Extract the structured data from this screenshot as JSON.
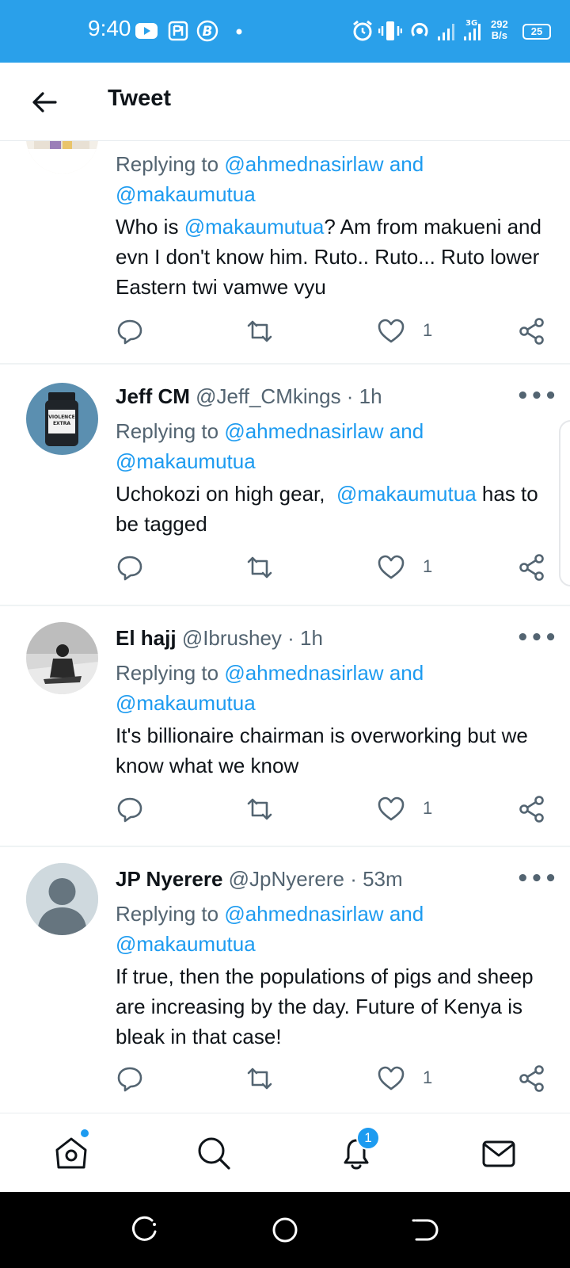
{
  "status_bar": {
    "time": "9:40",
    "net_speed_value": "292",
    "net_speed_unit": "B/s",
    "network_type": "3G",
    "battery": "25"
  },
  "header": {
    "title": "Tweet"
  },
  "colors": {
    "accent": "#1d9bf0",
    "status_bar": "#2aa0ea",
    "muted": "#536471"
  },
  "tweets": [
    {
      "reply_label": "Replying to",
      "reply_to_1": "@ahmednasirlaw",
      "reply_and": "and",
      "reply_to_2": "@makaumutua",
      "text_parts": [
        "Who is ",
        "@makaumutua",
        "? Am from makueni and evn I don't know him. Ruto.. Ruto... Ruto lower Eastern twi vamwe vyu"
      ],
      "likes": "1"
    },
    {
      "name": "Jeff CM",
      "handle": "@Jeff_CMkings",
      "time": "· 1h",
      "reply_label": "Replying to",
      "reply_to_1": "@ahmednasirlaw",
      "reply_and": "and",
      "reply_to_2": "@makaumutua",
      "text_parts": [
        "Uchokozi on high gear,  ",
        "@makaumutua",
        " has to be tagged"
      ],
      "likes": "1"
    },
    {
      "name": "El hajj",
      "handle": "@Ibrushey",
      "time": "· 1h",
      "reply_label": "Replying to",
      "reply_to_1": "@ahmednasirlaw",
      "reply_and": "and",
      "reply_to_2": "@makaumutua",
      "text": "It's billionaire chairman is overworking but we know what we know",
      "likes": "1"
    },
    {
      "name": "JP Nyerere",
      "handle": "@JpNyerere",
      "time": "· 53m",
      "reply_label": "Replying to",
      "reply_to_1": "@ahmednasirlaw",
      "reply_and": "and",
      "reply_to_2": "@makaumutua",
      "text": "If true, then the populations of pigs and sheep are increasing by the day. Future of Kenya is bleak in that case!",
      "likes": "1"
    }
  ],
  "avatar_labels": {
    "jeff": [
      "VIOLENCE",
      "EXTRA"
    ]
  },
  "bottom_nav": {
    "items": [
      "home-icon",
      "search-icon",
      "notifications-icon",
      "messages-icon"
    ],
    "notification_count": "1"
  },
  "more_label": "•••"
}
